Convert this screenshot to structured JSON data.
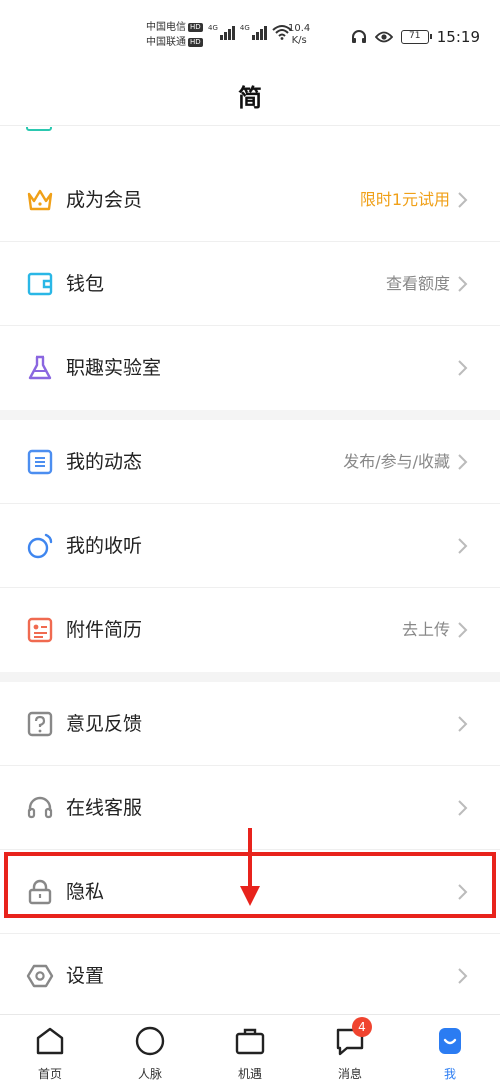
{
  "status_bar": {
    "carrier_1": "中国电信",
    "carrier_2": "中国联通",
    "hd": "HD",
    "network": "4G",
    "speed_value": "10.4",
    "speed_unit": "K/s",
    "battery": "71",
    "time": "15:19"
  },
  "header": {
    "title": "简"
  },
  "groups": [
    {
      "items": [
        {
          "label": "成为会员",
          "hint": "限时1元试用",
          "icon": "crown-icon"
        },
        {
          "label": "钱包",
          "hint": "查看额度",
          "icon": "wallet-icon"
        },
        {
          "label": "职趣实验室",
          "hint": "",
          "icon": "flask-icon"
        }
      ]
    },
    {
      "items": [
        {
          "label": "我的动态",
          "hint": "发布/参与/收藏",
          "icon": "feed-icon"
        },
        {
          "label": "我的收听",
          "hint": "",
          "icon": "listen-icon"
        },
        {
          "label": "附件简历",
          "hint": "去上传",
          "icon": "resume-icon"
        }
      ]
    },
    {
      "items": [
        {
          "label": "意见反馈",
          "hint": "",
          "icon": "feedback-icon"
        },
        {
          "label": "在线客服",
          "hint": "",
          "icon": "headset-icon"
        },
        {
          "label": "隐私",
          "hint": "",
          "icon": "lock-icon"
        },
        {
          "label": "设置",
          "hint": "",
          "icon": "settings-icon"
        }
      ]
    }
  ],
  "tabs": [
    {
      "label": "首页",
      "icon": "home-icon"
    },
    {
      "label": "人脉",
      "icon": "contacts-icon"
    },
    {
      "label": "机遇",
      "icon": "briefcase-icon"
    },
    {
      "label": "消息",
      "icon": "message-icon",
      "badge": "4"
    },
    {
      "label": "我",
      "icon": "profile-icon",
      "active": true
    }
  ],
  "colors": {
    "accent": "#2b7cf2",
    "member_gold": "#f0a018",
    "highlight_red": "#e8231c",
    "badge_red": "#f0442f"
  }
}
